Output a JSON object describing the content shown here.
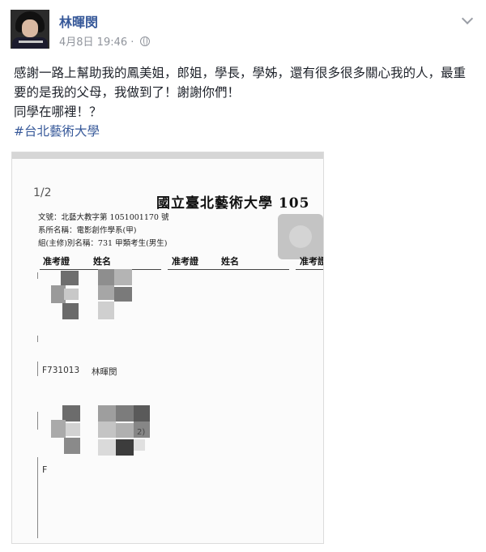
{
  "post": {
    "author": "林暉閔",
    "date": "4月8日 19:46",
    "separator": "·",
    "paragraph1": "感謝一路上幫助我的鳳美姐，郎姐，學長，學姊，還有很多很多關心我的人，最重要的是我的父母，我做到了！謝謝你們！",
    "paragraph2": "同學在哪裡！？",
    "hashtag": "#台北藝術大學"
  },
  "icons": {
    "audience": "globe-icon",
    "options": "chevron-down-icon",
    "avatar": "profile-photo"
  },
  "document": {
    "page_number": "1/2",
    "title": "國立臺北藝術大學 105",
    "line1": "文號：北藝大教字第 1051001170 號",
    "line2": "系所名稱：電影創作學系(甲)",
    "line3": "組(主修)別名稱：731 甲類考生(男生)",
    "headers": [
      "准考證",
      "姓名",
      "准考證",
      "姓名",
      "准考證"
    ],
    "row_id": "F731013",
    "row_name": "林暉閔",
    "fragment_2": "2)",
    "fragment_f": "F"
  },
  "colors": {
    "link": "#365899",
    "meta": "#90949c",
    "text": "#1d2129"
  }
}
